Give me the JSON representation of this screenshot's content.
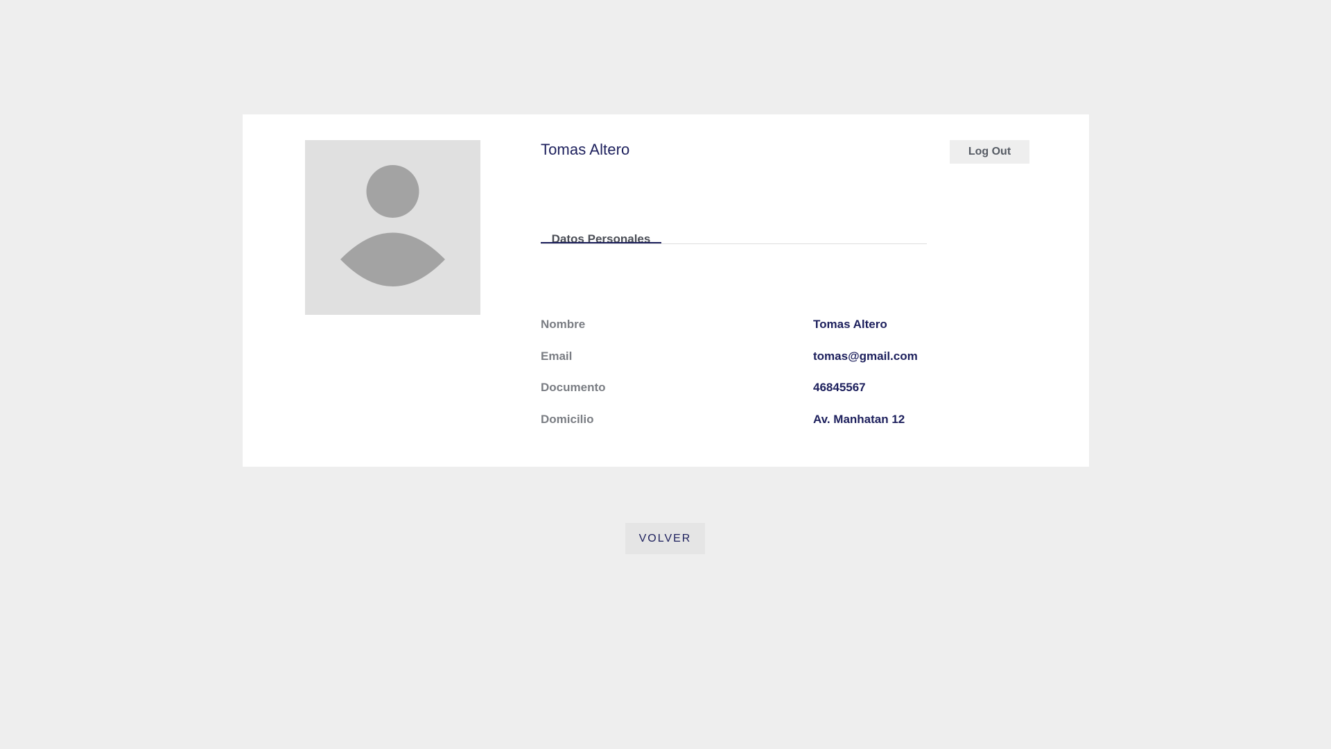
{
  "profile": {
    "name": "Tomas Altero",
    "logout_label": "Log Out",
    "avatar_icon": "user-placeholder-icon"
  },
  "tabs": [
    {
      "label": "Datos Personales",
      "active": true
    }
  ],
  "fields": [
    {
      "label": "Nombre",
      "value": "Tomas Altero"
    },
    {
      "label": "Email",
      "value": "tomas@gmail.com"
    },
    {
      "label": "Documento",
      "value": "46845567"
    },
    {
      "label": "Domicilio",
      "value": "Av. Manhatan 12"
    }
  ],
  "actions": {
    "back_label": "VOLVER"
  },
  "colors": {
    "background": "#eeeeee",
    "card": "#ffffff",
    "accent": "#1c1f5c",
    "label_text": "#7a7d83",
    "avatar_bg": "#e0e0e0",
    "avatar_fg": "#a3a3a3"
  }
}
